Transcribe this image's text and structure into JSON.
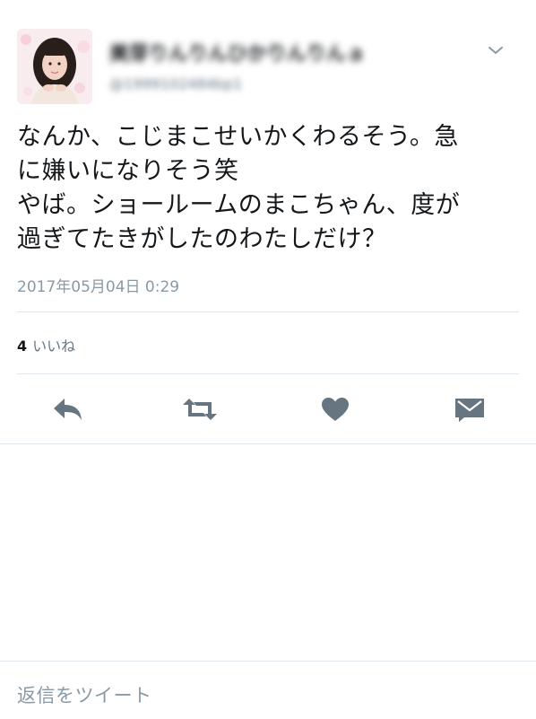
{
  "tweet": {
    "author_name": "美芽りんりんひかりんりんａ",
    "author_handle": "@1999102484bp1",
    "text_lines": [
      "なんか、こじまこせいかくわるそう。急",
      "に嫌いになりそう笑",
      "やば。ショールームのまこちゃん、度が",
      "過ぎてたきがしたのわたしだけ？"
    ],
    "timestamp": "2017年05月04日 0:29",
    "likes_count": "4",
    "likes_label": "いいね"
  },
  "actions": {
    "reply_icon": "reply-icon",
    "retweet_icon": "retweet-icon",
    "like_icon": "heart-icon",
    "message_icon": "direct-message-icon"
  },
  "reply_bar": {
    "placeholder": "返信をツイート"
  },
  "colors": {
    "icon_gray": "#66757f",
    "text_primary": "#14171a",
    "text_secondary": "#8899a6",
    "divider": "#e1e8ed"
  }
}
